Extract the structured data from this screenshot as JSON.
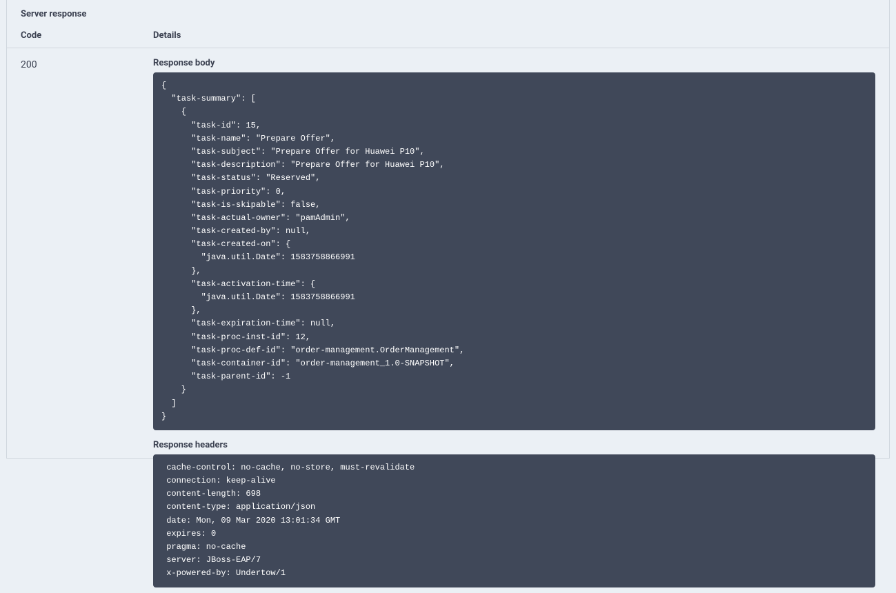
{
  "section_title": "Server response",
  "headers": {
    "code": "Code",
    "details": "Details"
  },
  "response": {
    "code": "200",
    "body_label": "Response body",
    "body_content": "{\n  \"task-summary\": [\n    {\n      \"task-id\": 15,\n      \"task-name\": \"Prepare Offer\",\n      \"task-subject\": \"Prepare Offer for Huawei P10\",\n      \"task-description\": \"Prepare Offer for Huawei P10\",\n      \"task-status\": \"Reserved\",\n      \"task-priority\": 0,\n      \"task-is-skipable\": false,\n      \"task-actual-owner\": \"pamAdmin\",\n      \"task-created-by\": null,\n      \"task-created-on\": {\n        \"java.util.Date\": 1583758866991\n      },\n      \"task-activation-time\": {\n        \"java.util.Date\": 1583758866991\n      },\n      \"task-expiration-time\": null,\n      \"task-proc-inst-id\": 12,\n      \"task-proc-def-id\": \"order-management.OrderManagement\",\n      \"task-container-id\": \"order-management_1.0-SNAPSHOT\",\n      \"task-parent-id\": -1\n    }\n  ]\n}",
    "headers_label": "Response headers",
    "headers_content": " cache-control: no-cache, no-store, must-revalidate \n connection: keep-alive \n content-length: 698 \n content-type: application/json \n date: Mon, 09 Mar 2020 13:01:34 GMT \n expires: 0 \n pragma: no-cache \n server: JBoss-EAP/7 \n x-powered-by: Undertow/1 "
  }
}
